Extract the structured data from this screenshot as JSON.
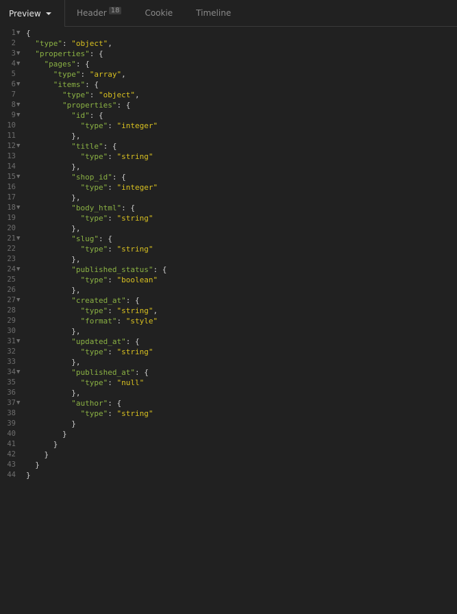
{
  "tabs": [
    {
      "label": "Preview",
      "active": true
    },
    {
      "label": "Header",
      "badge": "18"
    },
    {
      "label": "Cookie"
    },
    {
      "label": "Timeline"
    }
  ],
  "colors": {
    "key": "#8bb244",
    "string": "#d8c020",
    "punctuation": "#cfcfcf",
    "background": "#212121"
  },
  "code_lines": [
    {
      "i": "",
      "p": "{",
      "fold": true
    },
    {
      "i": "  ",
      "k": "type",
      "s": "object",
      "t": ","
    },
    {
      "i": "  ",
      "k": "properties",
      "t": ": {",
      "fold": true
    },
    {
      "i": "    ",
      "k": "pages",
      "t": ": {",
      "fold": true
    },
    {
      "i": "      ",
      "k": "type",
      "s": "array",
      "t": ","
    },
    {
      "i": "      ",
      "k": "items",
      "t": ": {",
      "fold": true
    },
    {
      "i": "        ",
      "k": "type",
      "s": "object",
      "t": ","
    },
    {
      "i": "        ",
      "k": "properties",
      "t": ": {",
      "fold": true
    },
    {
      "i": "          ",
      "k": "id",
      "t": ": {",
      "fold": true
    },
    {
      "i": "            ",
      "k": "type",
      "s": "integer"
    },
    {
      "i": "          ",
      "p": "},"
    },
    {
      "i": "          ",
      "k": "title",
      "t": ": {",
      "fold": true
    },
    {
      "i": "            ",
      "k": "type",
      "s": "string"
    },
    {
      "i": "          ",
      "p": "},"
    },
    {
      "i": "          ",
      "k": "shop_id",
      "t": ": {",
      "fold": true
    },
    {
      "i": "            ",
      "k": "type",
      "s": "integer"
    },
    {
      "i": "          ",
      "p": "},"
    },
    {
      "i": "          ",
      "k": "body_html",
      "t": ": {",
      "fold": true
    },
    {
      "i": "            ",
      "k": "type",
      "s": "string"
    },
    {
      "i": "          ",
      "p": "},"
    },
    {
      "i": "          ",
      "k": "slug",
      "t": ": {",
      "fold": true
    },
    {
      "i": "            ",
      "k": "type",
      "s": "string"
    },
    {
      "i": "          ",
      "p": "},"
    },
    {
      "i": "          ",
      "k": "published_status",
      "t": ": {",
      "fold": true
    },
    {
      "i": "            ",
      "k": "type",
      "s": "boolean"
    },
    {
      "i": "          ",
      "p": "},"
    },
    {
      "i": "          ",
      "k": "created_at",
      "t": ": {",
      "fold": true
    },
    {
      "i": "            ",
      "k": "type",
      "s": "string",
      "t": ","
    },
    {
      "i": "            ",
      "k": "format",
      "s": "style"
    },
    {
      "i": "          ",
      "p": "},"
    },
    {
      "i": "          ",
      "k": "updated_at",
      "t": ": {",
      "fold": true
    },
    {
      "i": "            ",
      "k": "type",
      "s": "string"
    },
    {
      "i": "          ",
      "p": "},"
    },
    {
      "i": "          ",
      "k": "published_at",
      "t": ": {",
      "fold": true
    },
    {
      "i": "            ",
      "k": "type",
      "s": "null"
    },
    {
      "i": "          ",
      "p": "},"
    },
    {
      "i": "          ",
      "k": "author",
      "t": ": {",
      "fold": true
    },
    {
      "i": "            ",
      "k": "type",
      "s": "string"
    },
    {
      "i": "          ",
      "p": "}"
    },
    {
      "i": "        ",
      "p": "}"
    },
    {
      "i": "      ",
      "p": "}"
    },
    {
      "i": "    ",
      "p": "}"
    },
    {
      "i": "  ",
      "p": "}"
    },
    {
      "i": "",
      "p": "}"
    }
  ]
}
